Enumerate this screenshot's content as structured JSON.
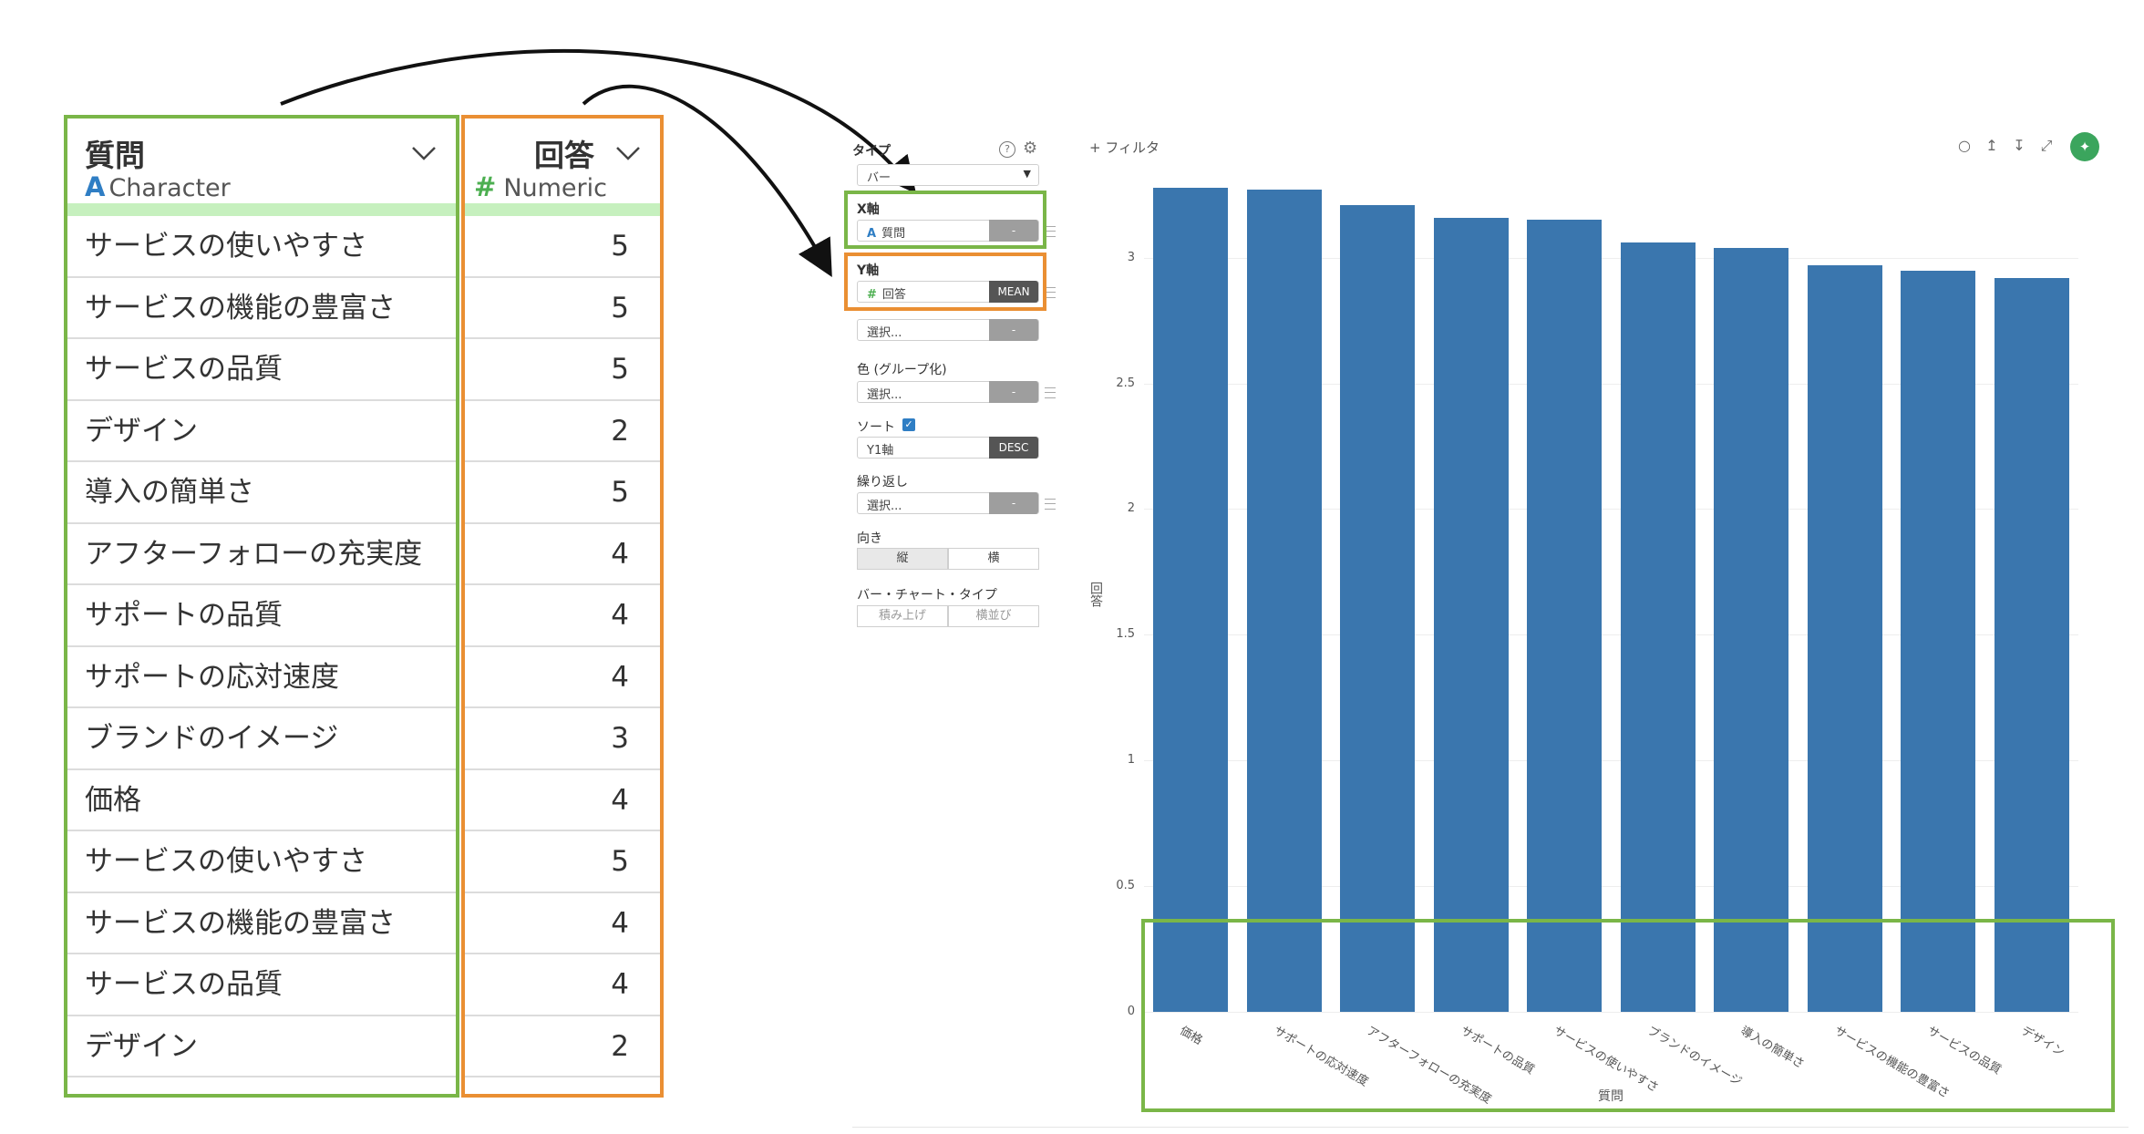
{
  "table": {
    "question_col": {
      "title": "質問",
      "type_icon": "A",
      "type_label": "Character"
    },
    "answer_col": {
      "title": "回答",
      "type_icon": "#",
      "type_label": "Numeric"
    },
    "rows": [
      {
        "q": "サービスの使いやすさ",
        "a": "5"
      },
      {
        "q": "サービスの機能の豊富さ",
        "a": "5"
      },
      {
        "q": "サービスの品質",
        "a": "5"
      },
      {
        "q": "デザイン",
        "a": "2"
      },
      {
        "q": "導入の簡単さ",
        "a": "5"
      },
      {
        "q": "アフターフォローの充実度",
        "a": "4"
      },
      {
        "q": "サポートの品質",
        "a": "4"
      },
      {
        "q": "サポートの応対速度",
        "a": "4"
      },
      {
        "q": "ブランドのイメージ",
        "a": "3"
      },
      {
        "q": "価格",
        "a": "4"
      },
      {
        "q": "サービスの使いやすさ",
        "a": "5"
      },
      {
        "q": "サービスの機能の豊富さ",
        "a": "4"
      },
      {
        "q": "サービスの品質",
        "a": "4"
      },
      {
        "q": "デザイン",
        "a": "2"
      }
    ]
  },
  "panel": {
    "type_label": "タイプ",
    "type_value": "バー",
    "x_axis_label": "X軸",
    "x_axis_icon": "A",
    "x_axis_value": "質問",
    "x_axis_btn": "-",
    "y_axis_label": "Y軸",
    "y_axis_icon": "#",
    "y_axis_value": "回答",
    "y_axis_btn": "MEAN",
    "y2_placeholder": "選択...",
    "y2_btn": "-",
    "color_label": "色 (グループ化)",
    "color_placeholder": "選択...",
    "color_btn": "-",
    "sort_label": "ソート",
    "sort_value": "Y1軸",
    "sort_btn": "DESC",
    "repeat_label": "繰り返し",
    "repeat_placeholder": "選択...",
    "repeat_btn": "-",
    "orient_label": "向き",
    "orient_vertical": "縦",
    "orient_horizontal": "横",
    "bartype_label": "バー・チャート・タイプ",
    "bartype_stacked": "積み上げ",
    "bartype_side": "横並び"
  },
  "toolbar": {
    "filter_label": "+ フィルタ"
  },
  "colors": {
    "bar": "#3a76ae",
    "highlight_green": "#7ab648",
    "highlight_orange": "#ea8f33",
    "pin": "#3ba55d"
  },
  "chart_data": {
    "type": "bar",
    "categories": [
      "価格",
      "サポートの応対速度",
      "アフターフォローの充実度",
      "サポートの品質",
      "サービスの使いやすさ",
      "ブランドのイメージ",
      "導入の簡単さ",
      "サービスの機能の豊富さ",
      "サービスの品質",
      "デザイン"
    ],
    "values": [
      3.28,
      3.27,
      3.21,
      3.16,
      3.15,
      3.06,
      3.04,
      2.97,
      2.95,
      2.92
    ],
    "xlabel": "質問",
    "ylabel": "回答",
    "ylim": [
      0,
      3.3
    ],
    "yticks": [
      "0",
      "0.5",
      "1",
      "1.5",
      "2",
      "2.5",
      "3"
    ],
    "sort": "desc"
  }
}
